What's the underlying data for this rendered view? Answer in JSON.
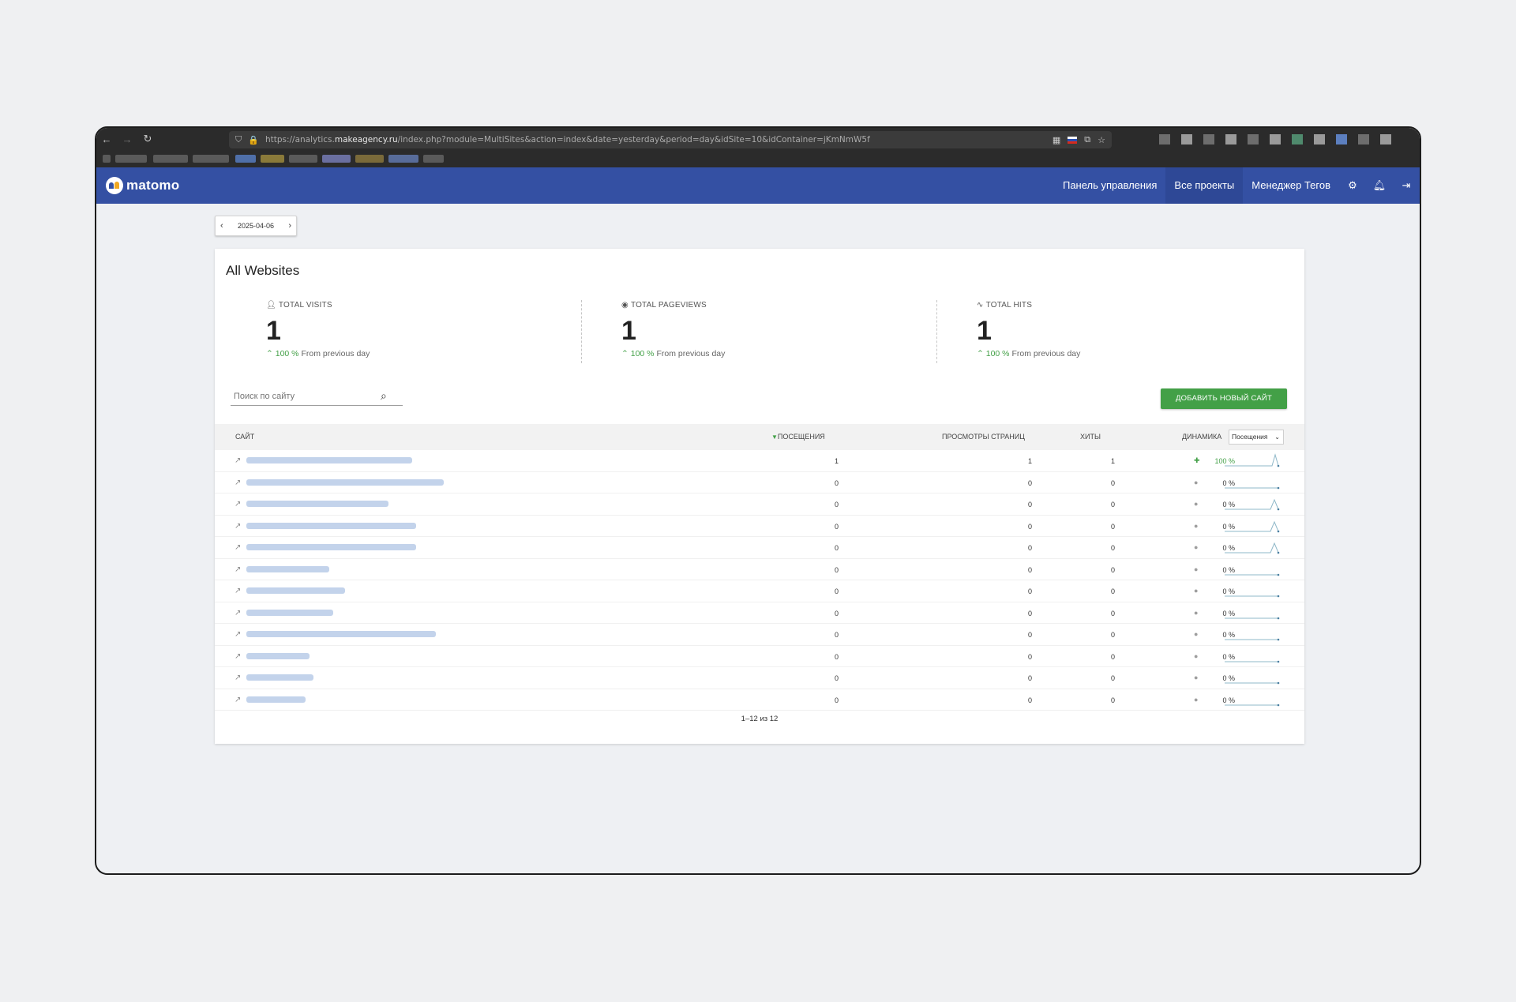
{
  "browser": {
    "url_prefix": "https://analytics.",
    "url_host": "makeagency.ru",
    "url_path": "/index.php?module=MultiSites&action=index&date=yesterday&period=day&idSite=10&idContainer=jKmNmW5f"
  },
  "app": {
    "logo_text": "matomo",
    "menu": [
      "Панель управления",
      "Все проекты",
      "Менеджер Тегов"
    ],
    "active_menu": "Все проекты"
  },
  "date_selector": {
    "value": "2025-04-06"
  },
  "card": {
    "title": "All Websites",
    "kpis": [
      {
        "label": "TOTAL VISITS",
        "value": "1",
        "change": "100 %",
        "suffix": "From previous day"
      },
      {
        "label": "TOTAL PAGEVIEWS",
        "value": "1",
        "change": "100 %",
        "suffix": "From previous day"
      },
      {
        "label": "TOTAL HITS",
        "value": "1",
        "change": "100 %",
        "suffix": "From previous day"
      }
    ],
    "search_placeholder": "Поиск по сайту",
    "add_button": "ДОБАВИТЬ НОВЫЙ САЙТ"
  },
  "table": {
    "headers": {
      "site": "САЙТ",
      "visits": "ПОСЕЩЕНИЯ",
      "pageviews": "ПРОСМОТРЫ СТРАНИЦ",
      "hits": "ХИТЫ",
      "evolution": "ДИНАМИКА"
    },
    "evolution_metric": "Посещения",
    "rows": [
      {
        "visits": "1",
        "pageviews": "1",
        "hits": "1",
        "evolution": "100 %",
        "trend": "up",
        "spark": "peak-end"
      },
      {
        "visits": "0",
        "pageviews": "0",
        "hits": "0",
        "evolution": "0 %",
        "trend": "flat",
        "spark": "flat"
      },
      {
        "visits": "0",
        "pageviews": "0",
        "hits": "0",
        "evolution": "0 %",
        "trend": "flat",
        "spark": "peak"
      },
      {
        "visits": "0",
        "pageviews": "0",
        "hits": "0",
        "evolution": "0 %",
        "trend": "flat",
        "spark": "peak"
      },
      {
        "visits": "0",
        "pageviews": "0",
        "hits": "0",
        "evolution": "0 %",
        "trend": "flat",
        "spark": "peak"
      },
      {
        "visits": "0",
        "pageviews": "0",
        "hits": "0",
        "evolution": "0 %",
        "trend": "flat",
        "spark": "flat"
      },
      {
        "visits": "0",
        "pageviews": "0",
        "hits": "0",
        "evolution": "0 %",
        "trend": "flat",
        "spark": "flat"
      },
      {
        "visits": "0",
        "pageviews": "0",
        "hits": "0",
        "evolution": "0 %",
        "trend": "flat",
        "spark": "flat"
      },
      {
        "visits": "0",
        "pageviews": "0",
        "hits": "0",
        "evolution": "0 %",
        "trend": "flat",
        "spark": "flat"
      },
      {
        "visits": "0",
        "pageviews": "0",
        "hits": "0",
        "evolution": "0 %",
        "trend": "flat",
        "spark": "flat"
      },
      {
        "visits": "0",
        "pageviews": "0",
        "hits": "0",
        "evolution": "0 %",
        "trend": "flat",
        "spark": "flat"
      },
      {
        "visits": "0",
        "pageviews": "0",
        "hits": "0",
        "evolution": "0 %",
        "trend": "flat",
        "spark": "flat"
      }
    ],
    "pagination": "1–12 из 12"
  },
  "colors": {
    "header": "#3450a3",
    "accent_green": "#43a047"
  }
}
